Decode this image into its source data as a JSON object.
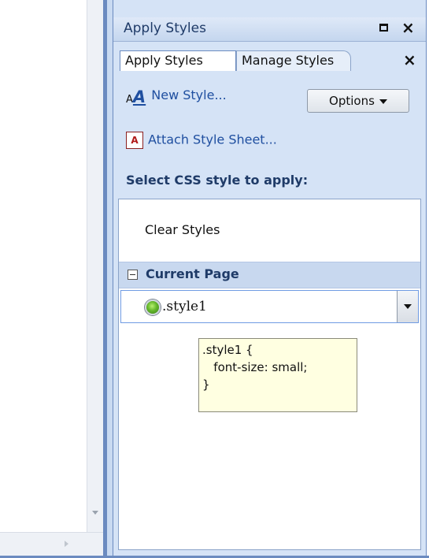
{
  "panel": {
    "title": "Apply Styles",
    "tabs": [
      {
        "label": "Apply Styles",
        "active": true
      },
      {
        "label": "Manage Styles",
        "active": false
      }
    ]
  },
  "toolbar": {
    "new_style_label": "New Style...",
    "options_label": "Options",
    "attach_label": "Attach Style Sheet..."
  },
  "list": {
    "header": "Select CSS style to apply:",
    "clear_styles": "Clear Styles",
    "group_label": "Current Page",
    "styles": [
      {
        "name": ".style1",
        "status_color": "#64b72b"
      }
    ]
  },
  "tooltip": {
    "lines": [
      ".style1 {",
      "   font-size: small;",
      "}"
    ]
  },
  "colors": {
    "panel_bg": "#d5e3f6",
    "accent": "#6b8bc0",
    "link": "#1f4fa0",
    "tooltip_bg": "#ffffe1"
  }
}
